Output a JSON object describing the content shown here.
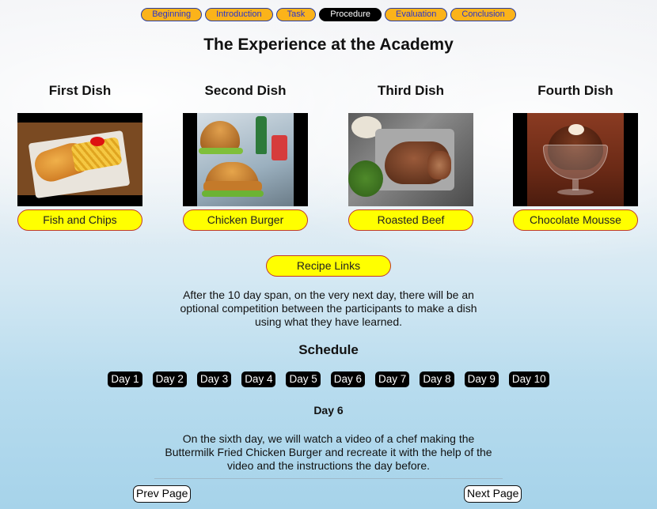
{
  "nav": {
    "items": [
      {
        "label": "Beginning"
      },
      {
        "label": "Introduction"
      },
      {
        "label": "Task"
      },
      {
        "label": "Procedure"
      },
      {
        "label": "Evaluation"
      },
      {
        "label": "Conclusion"
      }
    ],
    "active": "Procedure"
  },
  "page_title": "The Experience at the Academy",
  "dishes": [
    {
      "heading": "First Dish",
      "button": "Fish and Chips"
    },
    {
      "heading": "Second Dish",
      "button": "Chicken Burger"
    },
    {
      "heading": "Third Dish",
      "button": "Roasted Beef"
    },
    {
      "heading": "Fourth Dish",
      "button": "Chocolate Mousse"
    }
  ],
  "recipe_links_label": "Recipe Links",
  "intro_text": "After the 10 day span, on the very next day, there will be an optional competition between the participants to make a dish using what they have learned.",
  "schedule": {
    "title": "Schedule",
    "days": [
      "Day 1",
      "Day 2",
      "Day 3",
      "Day 4",
      "Day 5",
      "Day 6",
      "Day 7",
      "Day 8",
      "Day 9",
      "Day 10"
    ],
    "selected_title": "Day 6",
    "selected_text": "On the sixth day, we will watch a video of a chef making the Buttermilk Fried Chicken Burger and recreate it with the help of the video and the instructions the day before."
  },
  "pager": {
    "prev_label": "Prev Page",
    "next_label": "Next Page"
  },
  "colors": {
    "nav_button": "#fbb31a",
    "nav_text": "#2b35c9",
    "dish_button": "#ffff00",
    "day_button": "#000000"
  }
}
